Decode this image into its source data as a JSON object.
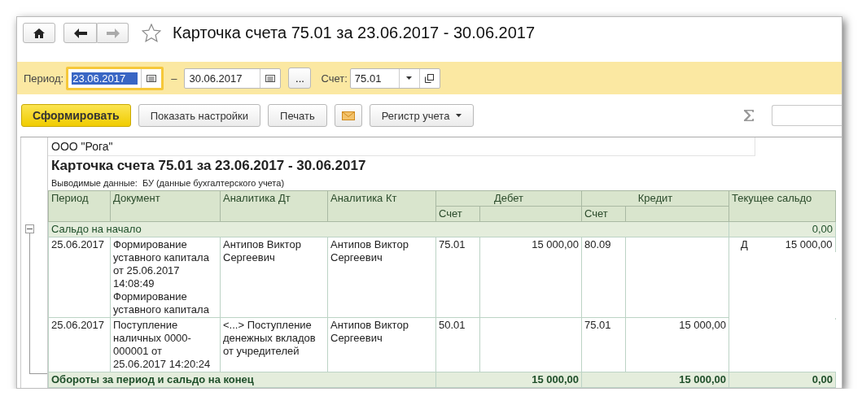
{
  "toolbar": {
    "title": "Карточка счета 75.01 за 23.06.2017 - 30.06.2017",
    "favorite": false,
    "forward_disabled": true
  },
  "filter": {
    "period_label": "Период:",
    "date_from": "23.06.2017",
    "date_from_selected": true,
    "separator": "–",
    "date_to": "30.06.2017",
    "more_button": "...",
    "account_label": "Счет:",
    "account": "75.01"
  },
  "actions": [
    {
      "kind": "primary",
      "label": "Сформировать"
    },
    {
      "kind": "default",
      "label": "Показать настройки"
    },
    {
      "kind": "default",
      "label": "Печать"
    },
    {
      "kind": "email"
    },
    {
      "kind": "dropdown",
      "label": "Регистр учета"
    }
  ],
  "report": {
    "organization": "ООО \"Рога\"",
    "title": "Карточка счета 75.01 за 23.06.2017 - 30.06.2017",
    "output_note": "Выводимые данные:  БУ (данные бухгалтерского учета)",
    "columns": [
      {
        "kind": "single",
        "label": "Период"
      },
      {
        "kind": "single",
        "label": "Документ"
      },
      {
        "kind": "single",
        "label": "Аналитика Дт"
      },
      {
        "kind": "single",
        "label": "Аналитика Кт"
      },
      {
        "kind": "group",
        "label": "Дебет",
        "sub": "Счет"
      },
      {
        "kind": "group",
        "label": "Кредит",
        "sub": "Счет"
      },
      {
        "kind": "single",
        "label": "Текущее сальдо"
      }
    ],
    "opening": {
      "label": "Сальдо на начало",
      "balance": "0,00",
      "expanded": true
    },
    "rows": [
      {
        "period": "25.06.2017",
        "document": "Формирование уставного капитала от 25.06.2017 14:08:49 Формирование уставного капитала",
        "analytics_dt": "Антипов Виктор Сергеевич",
        "analytics_kt": "Антипов Виктор Сергеевич",
        "debit_account": "75.01",
        "debit_amount": "15 000,00",
        "credit_account": "80.09",
        "balance_side": "Д",
        "balance": "15 000,00"
      },
      {
        "period": "25.06.2017",
        "document": "Поступление наличных 0000-000001 от 25.06.2017 14:20:24",
        "analytics_dt": "<...> Поступление денежных вкладов от учредителей",
        "analytics_kt": "Антипов Виктор Сергеевич",
        "debit_account": "50.01",
        "credit_account": "75.01",
        "credit_amount": "15 000,00"
      }
    ],
    "totals": {
      "label": "Обороты за период и сальдо на конец",
      "debit": "15 000,00",
      "credit": "15 000,00",
      "balance": "0,00"
    }
  }
}
